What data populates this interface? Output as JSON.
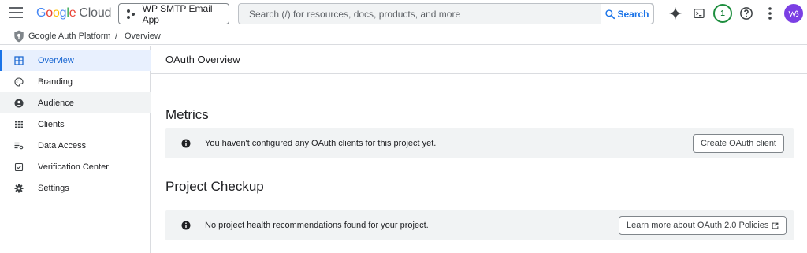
{
  "header": {
    "logo_google": "Google",
    "logo_cloud": "Cloud",
    "project_name": "WP SMTP Email App",
    "search_placeholder": "Search (/) for resources, docs, products, and more",
    "search_button": "Search",
    "notification_count": "1",
    "icons": [
      "menu-icon",
      "gemini-sparkle-icon",
      "cloud-shell-icon",
      "help-icon",
      "more-vert-icon",
      "avatar"
    ]
  },
  "breadcrumb": {
    "root": "Google Auth Platform",
    "separator": "/",
    "current": "Overview"
  },
  "sidebar": {
    "items": [
      {
        "label": "Overview",
        "icon": "dashboard-icon",
        "state": "active"
      },
      {
        "label": "Branding",
        "icon": "palette-icon",
        "state": ""
      },
      {
        "label": "Audience",
        "icon": "person-circle-icon",
        "state": "hover"
      },
      {
        "label": "Clients",
        "icon": "grid-dots-icon",
        "state": ""
      },
      {
        "label": "Data Access",
        "icon": "data-access-icon",
        "state": ""
      },
      {
        "label": "Verification Center",
        "icon": "verified-checkbox-icon",
        "state": ""
      },
      {
        "label": "Settings",
        "icon": "gear-icon",
        "state": ""
      }
    ]
  },
  "main": {
    "page_title": "OAuth Overview",
    "metrics": {
      "title": "Metrics",
      "message": "You haven't configured any OAuth clients for this project yet.",
      "button": "Create OAuth client"
    },
    "checkup": {
      "title": "Project Checkup",
      "message": "No project health recommendations found for your project.",
      "button": "Learn more about OAuth 2.0 Policies"
    }
  },
  "colors": {
    "accent": "#1a73e8",
    "active_bg": "#e8f0fe",
    "info_bar_bg": "#f1f3f4",
    "notification_ring": "#1e8e3e",
    "avatar_bg": "#7b3fe4"
  }
}
